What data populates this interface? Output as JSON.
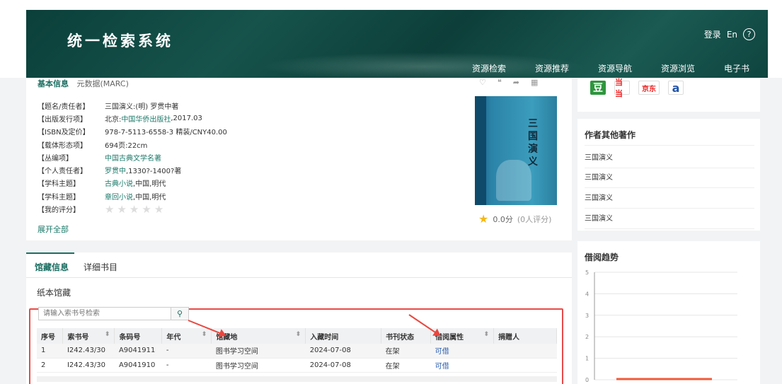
{
  "header": {
    "brand": "统一检索系统",
    "login": "登录",
    "lang": "En",
    "help_icon": "question-circle-icon",
    "nav": [
      "资源检索",
      "资源推荐",
      "资源导航",
      "资源浏览",
      "电子书"
    ]
  },
  "info": {
    "tabs": [
      "基本信息",
      "元数据(MARC)"
    ],
    "actions": [
      "heart-icon",
      "quote-icon",
      "share-icon",
      "qr-code-icon"
    ],
    "rows": [
      {
        "key": "【题名/责任者】",
        "value": "三国演义:(明) 罗贯中著"
      },
      {
        "key": "【出版发行项】",
        "prefix": "北京:",
        "link": "中国华侨出版社",
        "suffix": ",2017.03"
      },
      {
        "key": "【ISBN及定价】",
        "value": "978-7-5113-6558-3 精装/CNY40.00"
      },
      {
        "key": "【载体形态项】",
        "value": "694页:22cm"
      },
      {
        "key": "【丛编项】",
        "link": "中国古典文学名著"
      },
      {
        "key": "【个人责任者】",
        "link": "罗贯中",
        "suffix": ",1330?-1400?著"
      },
      {
        "key": "【学科主题】",
        "link": "古典小说",
        "suffix": ",中国,明代"
      },
      {
        "key": "【学科主题】",
        "link": "章回小说",
        "suffix": ",中国,明代"
      },
      {
        "key": "【我的评分】",
        "stars": 0
      }
    ],
    "expand": "展开全部",
    "book_title": "三国演义",
    "rating_score": "0.0分",
    "rating_count": "(0人评分)"
  },
  "holdings": {
    "tabs": [
      "馆藏信息",
      "详细书目"
    ],
    "paper_title": "纸本馆藏",
    "search_placeholder": "请输入索书号检索",
    "columns": [
      "序号",
      "索书号",
      "条码号",
      "年代",
      "馆藏地",
      "入藏时间",
      "书刊状态",
      "借阅属性",
      "捐赠人"
    ],
    "rows": [
      [
        "1",
        "I242.43/30",
        "A9041911",
        "-",
        "图书学习空间",
        "2024-07-08",
        "在架",
        "可借",
        ""
      ],
      [
        "2",
        "I242.43/30",
        "A9041910",
        "-",
        "图书学习空间",
        "2024-07-08",
        "在架",
        "可借",
        ""
      ]
    ]
  },
  "buy": {
    "shops": [
      {
        "icon": "douban-icon",
        "label": "豆"
      },
      {
        "icon": "dangdang-icon",
        "label": "当当"
      },
      {
        "icon": "jd-icon",
        "label": "京东"
      },
      {
        "icon": "amazon-icon",
        "label": "a"
      }
    ]
  },
  "other_works": {
    "title": "作者其他著作",
    "items": [
      "三国演义",
      "三国演义",
      "三国演义",
      "三国演义"
    ]
  },
  "trend": {
    "title": "借阅趋势",
    "chart_data": {
      "type": "line",
      "y_ticks": [
        0,
        1,
        2,
        3,
        4,
        5
      ],
      "ylim": [
        0,
        5
      ],
      "series_color": "#f05a3a",
      "values": [
        0,
        0
      ]
    }
  },
  "colors": {
    "accent": "#1b6e62",
    "header_bg": "#0f4540",
    "highlight": "#e84a4a"
  }
}
